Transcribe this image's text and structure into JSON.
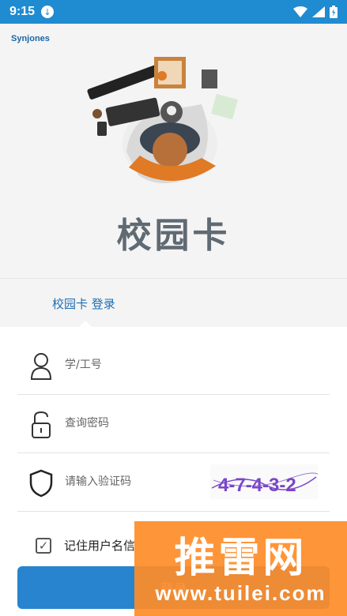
{
  "status_bar": {
    "time": "9:15"
  },
  "header": {
    "brand": "Synjones",
    "title": "校园卡"
  },
  "tab": {
    "label": "校园卡 登录"
  },
  "form": {
    "account_placeholder": "学/工号",
    "password_placeholder": "查询密码",
    "captcha_placeholder": "请输入验证码",
    "captcha_text": "4-7-4-3-2",
    "remember_label": "记住用户名信",
    "login_label": "登录"
  },
  "watermark": {
    "main": "推雷网",
    "sub": "www.tuilei.com"
  },
  "colors": {
    "accent": "#2884ce",
    "statusbar": "#1f8bd0",
    "watermark": "#ff8c28"
  }
}
